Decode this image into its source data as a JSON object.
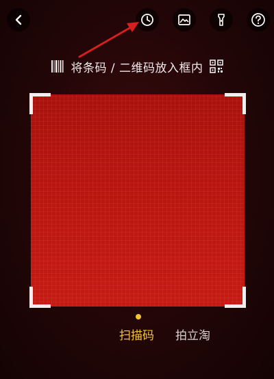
{
  "toolbar": {
    "back": "back-icon",
    "history": "clock-icon",
    "album": "image-icon",
    "flashlight": "flashlight-icon",
    "help": "help-icon"
  },
  "hint": {
    "text": "将条码 / 二维码放入框内",
    "left_icon": "barcode-icon",
    "right_icon": "qr-code-icon"
  },
  "modes": [
    {
      "label": "扫描码",
      "active": true
    },
    {
      "label": "拍立淘",
      "active": false
    }
  ],
  "colors": {
    "accent": "#f3c531",
    "scan_area": "#b3130e",
    "annotation_arrow": "#d61f1f"
  }
}
